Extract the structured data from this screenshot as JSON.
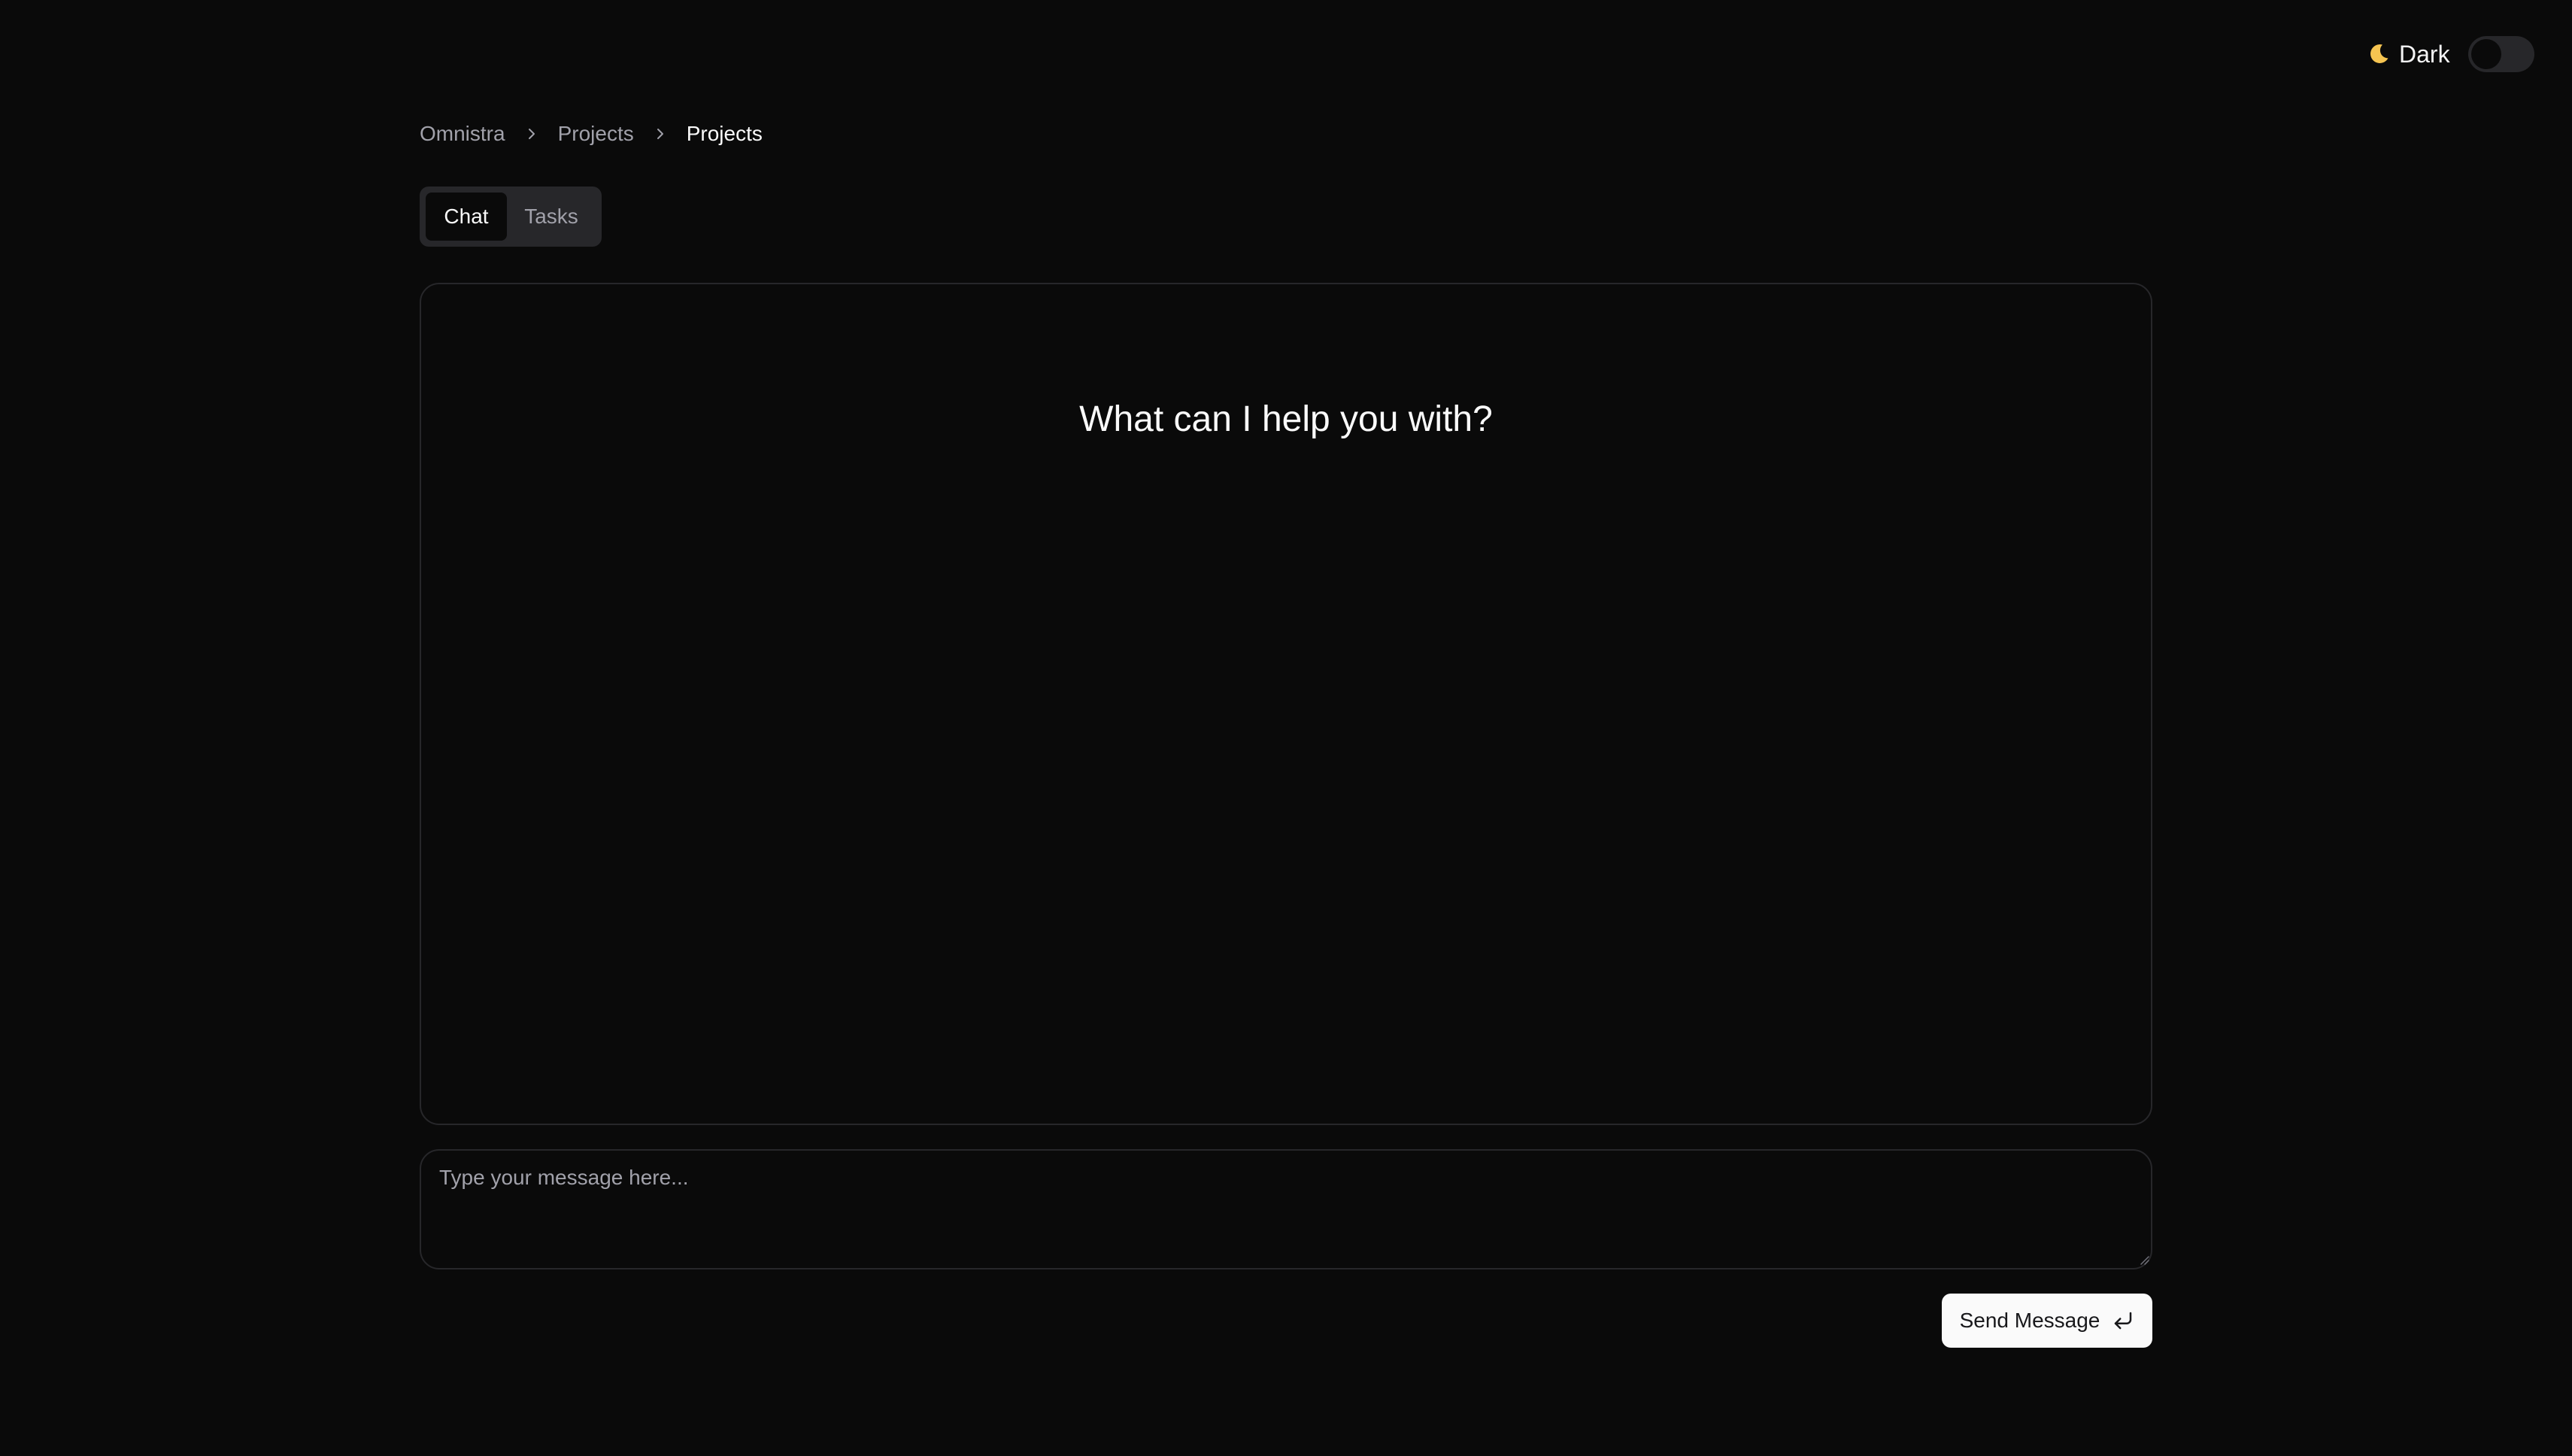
{
  "theme": {
    "label": "Dark",
    "icon": "moon-icon",
    "enabled": false
  },
  "breadcrumb": {
    "items": [
      "Omnistra",
      "Projects",
      "Projects"
    ],
    "separator_icon": "chevron-right-icon"
  },
  "tabs": [
    {
      "label": "Chat",
      "active": true
    },
    {
      "label": "Tasks",
      "active": false
    }
  ],
  "chat": {
    "heading": "What can I help you with?"
  },
  "input": {
    "placeholder": "Type your message here...",
    "value": ""
  },
  "send_button": {
    "label": "Send Message",
    "icon": "enter-icon"
  },
  "colors": {
    "background": "#0a0a0a",
    "border": "#27272a",
    "text": "#fafafa",
    "muted_text": "#a1a1aa",
    "button_bg": "#fafafa",
    "moon": "#f5c451"
  }
}
